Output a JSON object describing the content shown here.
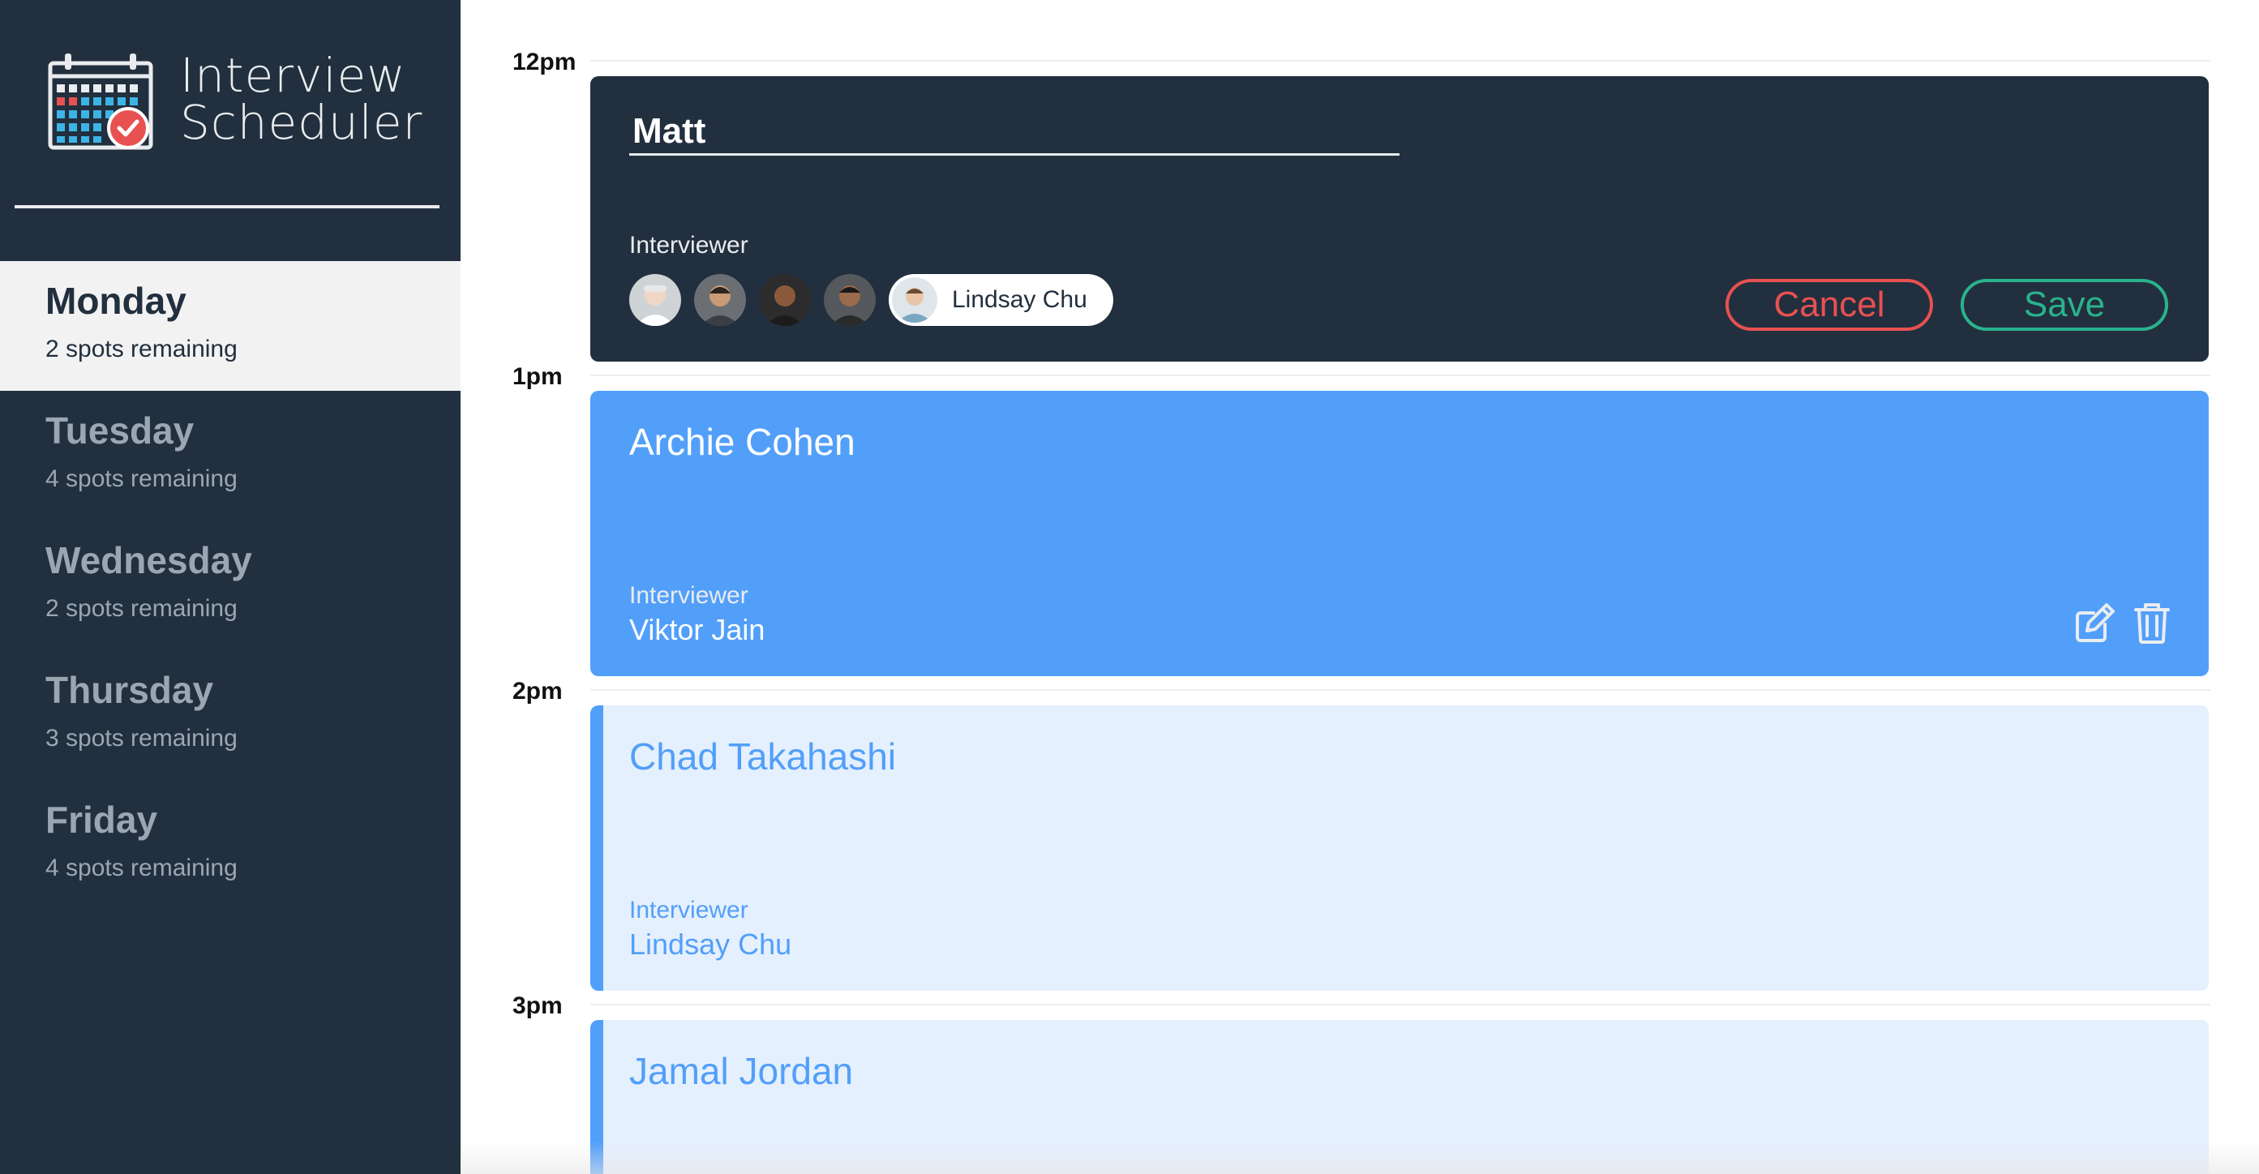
{
  "sidebar": {
    "app_title_line1": "Interview",
    "app_title_line2": "Scheduler",
    "logo_icon": "calendar-check-icon",
    "days": [
      {
        "name": "Monday",
        "spots": "2 spots remaining",
        "selected": true
      },
      {
        "name": "Tuesday",
        "spots": "4 spots remaining",
        "selected": false
      },
      {
        "name": "Wednesday",
        "spots": "2 spots remaining",
        "selected": false
      },
      {
        "name": "Thursday",
        "spots": "3 spots remaining",
        "selected": false
      },
      {
        "name": "Friday",
        "spots": "4 spots remaining",
        "selected": false
      }
    ]
  },
  "schedule": {
    "times": [
      "12pm",
      "1pm",
      "2pm",
      "3pm"
    ],
    "form": {
      "student_name": "Matt",
      "interviewer_label": "Interviewer",
      "selected_interviewer": "Lindsay Chu",
      "cancel_label": "Cancel",
      "save_label": "Save"
    },
    "appointments": [
      {
        "student": "Archie Cohen",
        "interviewer_label": "Interviewer",
        "interviewer": "Viktor Jain"
      },
      {
        "student": "Chad Takahashi",
        "interviewer_label": "Interviewer",
        "interviewer": "Lindsay Chu"
      },
      {
        "student": "Jamal Jordan"
      }
    ]
  },
  "colors": {
    "sidebar_bg": "#222f3e",
    "accent_blue": "#529ffa",
    "light_blue": "#e5f0fe",
    "danger": "#e85151",
    "success": "#29b38c"
  }
}
